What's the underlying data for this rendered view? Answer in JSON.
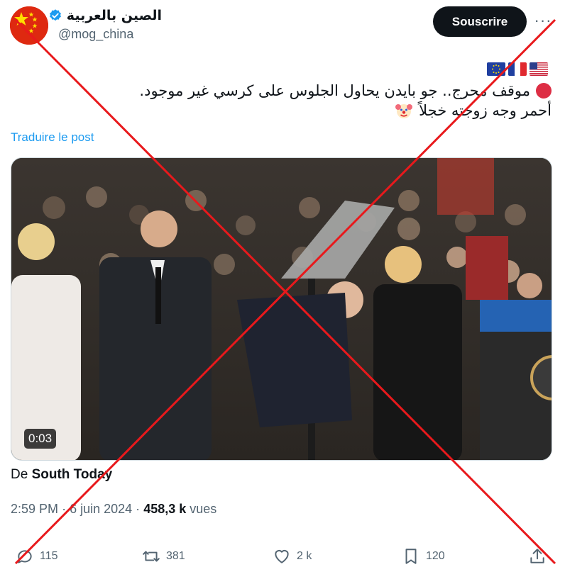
{
  "account": {
    "display_name": "الصين بالعربية",
    "handle": "@mog_china",
    "verified": true
  },
  "header": {
    "subscribe_label": "Souscrire",
    "more_label": "···"
  },
  "tweet": {
    "line1": "موقف محرج.. جو بايدن يحاول الجلوس على كرسي غير موجود.",
    "line2": "أحمر وجه زوجته خجلاً",
    "flags": [
      "eu-flag",
      "france-flag",
      "usa-flag"
    ],
    "translate_label": "Traduire le post"
  },
  "media": {
    "duration": "0:03"
  },
  "source": {
    "prefix": "De",
    "name": "South Today"
  },
  "meta": {
    "time": "2:59 PM",
    "date": "6 juin 2024",
    "views_count": "458,3 k",
    "views_label": "vues",
    "separator": "·"
  },
  "actions": {
    "replies": "115",
    "reposts": "381",
    "likes": "2 k",
    "bookmarks": "120"
  },
  "colors": {
    "accent": "#1d9bf0",
    "cross": "#e8191c",
    "button_bg": "#0f1419"
  }
}
